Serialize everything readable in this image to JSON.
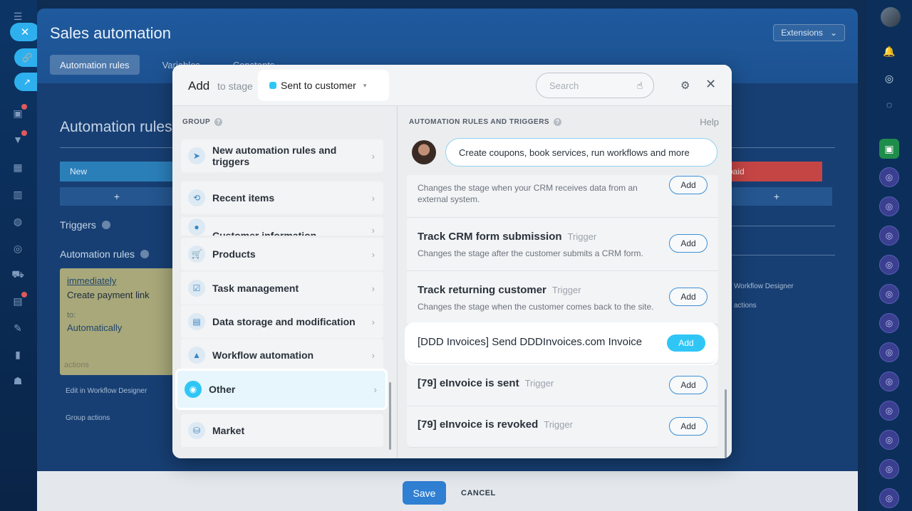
{
  "page": {
    "title": "Sales automation",
    "extensions_label": "Extensions",
    "tabs": [
      "Automation rules",
      "Variables",
      "Constants"
    ],
    "section_title": "Automation rules",
    "new_label": "New",
    "paid_label": "paid",
    "plus": "+",
    "triggers_label": "Triggers",
    "automation_rules_label": "Automation rules",
    "card": {
      "when": "immediately",
      "action": "Create payment link",
      "to_label": "to:",
      "to_value": "Automatically",
      "actions": "actions",
      "edit": "ed"
    },
    "edit_designer": "Edit in Workflow Designer",
    "group_actions": "Group actions",
    "right_designer": "Workflow Designer",
    "right_actions": "actions"
  },
  "footer": {
    "save": "Save",
    "cancel": "CANCEL"
  },
  "modal": {
    "add_label": "Add",
    "to_stage_label": "to stage",
    "stage_value": "Sent to customer",
    "search_placeholder": "Search",
    "group_heading": "GROUP",
    "groups": [
      {
        "label": "New automation rules and triggers",
        "icon": "rocket-icon",
        "glyph": "➤"
      },
      {
        "label": "Recent items",
        "icon": "history-icon",
        "glyph": "⟲"
      },
      {
        "label": "Customer information",
        "icon": "user-icon",
        "glyph": "●"
      },
      {
        "label": "Products",
        "icon": "cart-icon",
        "glyph": "🛒"
      },
      {
        "label": "Task management",
        "icon": "task-icon",
        "glyph": "☑"
      },
      {
        "label": "Data storage and modification",
        "icon": "database-icon",
        "glyph": "▤"
      },
      {
        "label": "Workflow automation",
        "icon": "workflow-icon",
        "glyph": "▲"
      },
      {
        "label": "Other",
        "icon": "robot-icon",
        "glyph": "◉"
      },
      {
        "label": "Market",
        "icon": "market-icon",
        "glyph": "⛁"
      }
    ],
    "rules_heading": "AUTOMATION RULES AND TRIGGERS",
    "help": "Help",
    "bubble_text": "Create coupons, book services, run workflows and more",
    "trigger_tag": "Trigger",
    "add_btn": "Add",
    "rules": [
      {
        "title": "",
        "desc": "Changes the stage when your CRM receives data from an external system."
      },
      {
        "title": "Track CRM form submission",
        "desc": "Changes the stage after the customer submits a CRM form."
      },
      {
        "title": "Track returning customer",
        "desc": "Changes the stage when the customer comes back to the site."
      },
      {
        "title": "[DDD Invoices] Send DDDInvoices.com Invoice",
        "desc": ""
      },
      {
        "title": "[79] eInvoice is sent",
        "desc": ""
      },
      {
        "title": "[79] eInvoice is revoked",
        "desc": ""
      }
    ]
  }
}
